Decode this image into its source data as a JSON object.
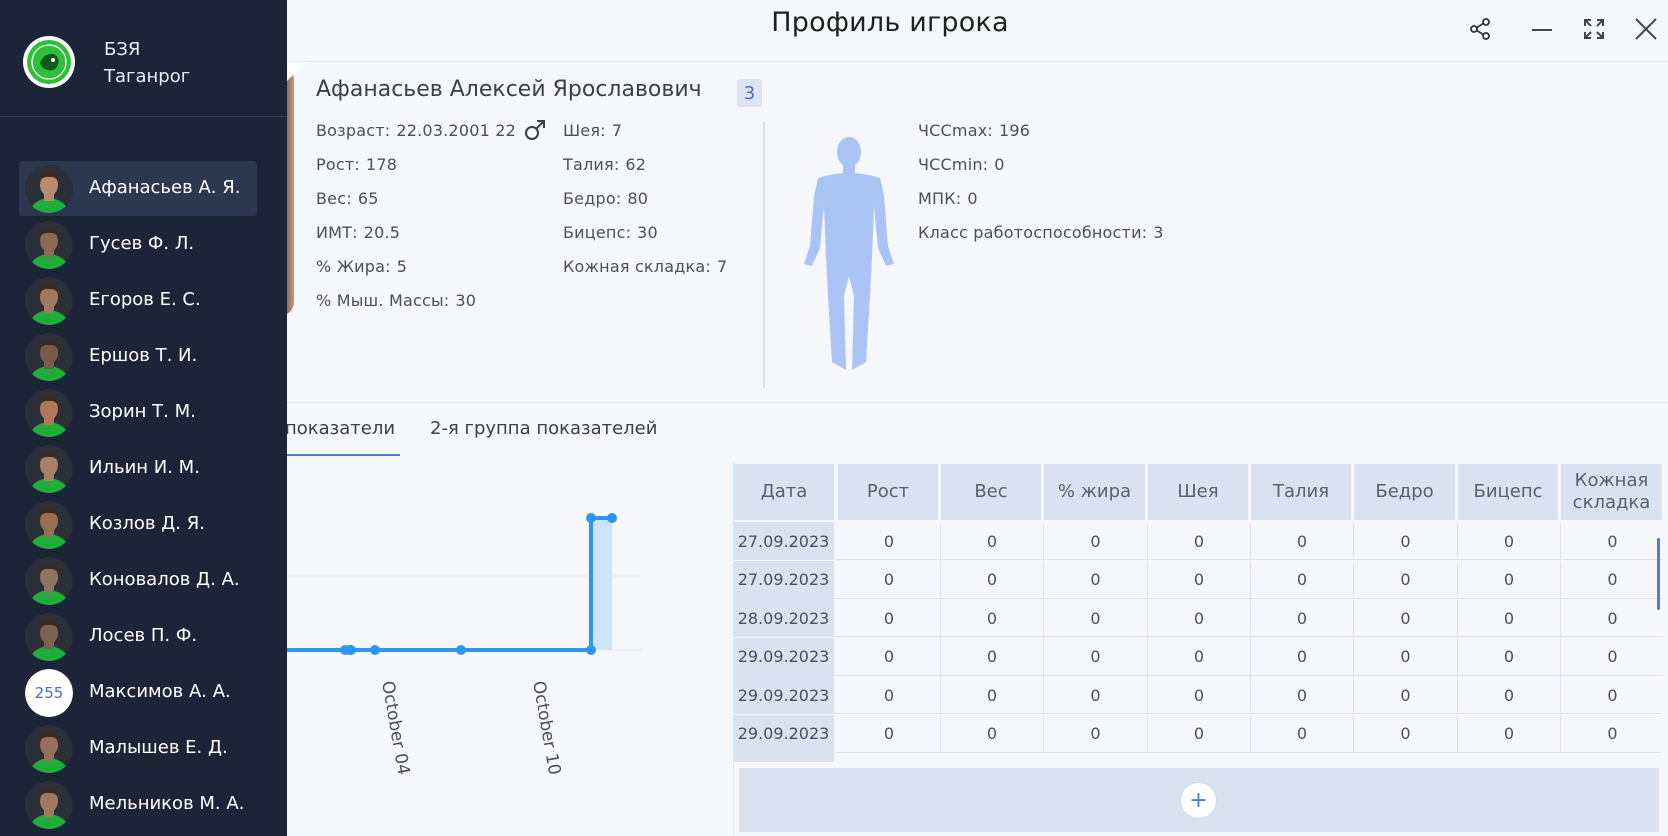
{
  "window": {
    "title": "Профиль игрока"
  },
  "organization": {
    "line1": "БЗЯ",
    "line2": "Таганрог"
  },
  "players": [
    {
      "name": "Афанасьев А. Я.",
      "active": true,
      "tone": "#b88a6e"
    },
    {
      "name": "Гусев Ф. Л.",
      "active": false,
      "tone": "#8a6a55"
    },
    {
      "name": "Егоров Е. С.",
      "active": false,
      "tone": "#a07a60"
    },
    {
      "name": "Ершов Т. И.",
      "active": false,
      "tone": "#7a5a48"
    },
    {
      "name": "Зорин Т. М.",
      "active": false,
      "tone": "#b07858"
    },
    {
      "name": "Ильин И. М.",
      "active": false,
      "tone": "#a88068"
    },
    {
      "name": "Козлов Д. Я.",
      "active": false,
      "tone": "#9a6e52"
    },
    {
      "name": "Коновалов Д. А.",
      "active": false,
      "tone": "#8e7462"
    },
    {
      "name": "Лосев П. Ф.",
      "active": false,
      "tone": "#7e6250"
    },
    {
      "name": "Максимов А. А.",
      "active": false,
      "number": "255"
    },
    {
      "name": "Малышев Е. Д.",
      "active": false,
      "tone": "#96705a"
    },
    {
      "name": "Мельников М. А.",
      "active": false,
      "tone": "#a27860"
    }
  ],
  "profile": {
    "full_name": "Афанасьев Алексей Ярославович",
    "badge": "3",
    "gender_icon": "male-icon",
    "stats_col1": [
      {
        "label": "Возраст:",
        "value": "22.03.2001 22"
      },
      {
        "label": "Рост:",
        "value": "178"
      },
      {
        "label": "Вес:",
        "value": "65"
      },
      {
        "label": "ИМТ:",
        "value": "20.5"
      },
      {
        "label": "% Жира:",
        "value": "5"
      },
      {
        "label": "% Мыш. Массы:",
        "value": "30"
      }
    ],
    "stats_col2": [
      {
        "label": "Шея:",
        "value": "7"
      },
      {
        "label": "Талия:",
        "value": "62"
      },
      {
        "label": "Бедро:",
        "value": "80"
      },
      {
        "label": "Бицепс:",
        "value": "30"
      },
      {
        "label": "Кожная складка:",
        "value": "7"
      }
    ],
    "stats_col3": [
      {
        "label": "ЧССmax:",
        "value": "196"
      },
      {
        "label": "ЧССmin:",
        "value": "0"
      },
      {
        "label": "МПК:",
        "value": "0"
      },
      {
        "label": "Класс работоспособности:",
        "value": "3"
      }
    ]
  },
  "tabs": [
    {
      "label": "показатели",
      "active": true
    },
    {
      "label": "2-я группа показателей",
      "active": false
    }
  ],
  "chart_data": {
    "type": "line",
    "x_ticks": [
      "October 04",
      "October 10"
    ],
    "series": [
      {
        "x": [
          "2023-09-27",
          "2023-09-27",
          "2023-09-28",
          "2023-09-29",
          "2023-10-03",
          "2023-10-09",
          "2023-10-09",
          "2023-10-10"
        ],
        "values": [
          0,
          0,
          0,
          0,
          0,
          0,
          65,
          65
        ]
      }
    ]
  },
  "table": {
    "columns": [
      "Дата",
      "Рост",
      "Вес",
      "% жира",
      "Шея",
      "Талия",
      "Бедро",
      "Бицепс",
      "Кожная складка"
    ],
    "rows": [
      [
        "27.09.2023",
        "0",
        "0",
        "0",
        "0",
        "0",
        "0",
        "0",
        "0"
      ],
      [
        "27.09.2023",
        "0",
        "0",
        "0",
        "0",
        "0",
        "0",
        "0",
        "0"
      ],
      [
        "28.09.2023",
        "0",
        "0",
        "0",
        "0",
        "0",
        "0",
        "0",
        "0"
      ],
      [
        "29.09.2023",
        "0",
        "0",
        "0",
        "0",
        "0",
        "0",
        "0",
        "0"
      ],
      [
        "29.09.2023",
        "0",
        "0",
        "0",
        "0",
        "0",
        "0",
        "0",
        "0"
      ],
      [
        "29.09.2023",
        "0",
        "0",
        "0",
        "0",
        "0",
        "0",
        "0",
        "0"
      ]
    ],
    "add_label": "+"
  },
  "colors": {
    "accent": "#4a7fd6",
    "sidebar": "#1c2538",
    "line": "#2e95f0",
    "figure": "#a9c4f5"
  }
}
